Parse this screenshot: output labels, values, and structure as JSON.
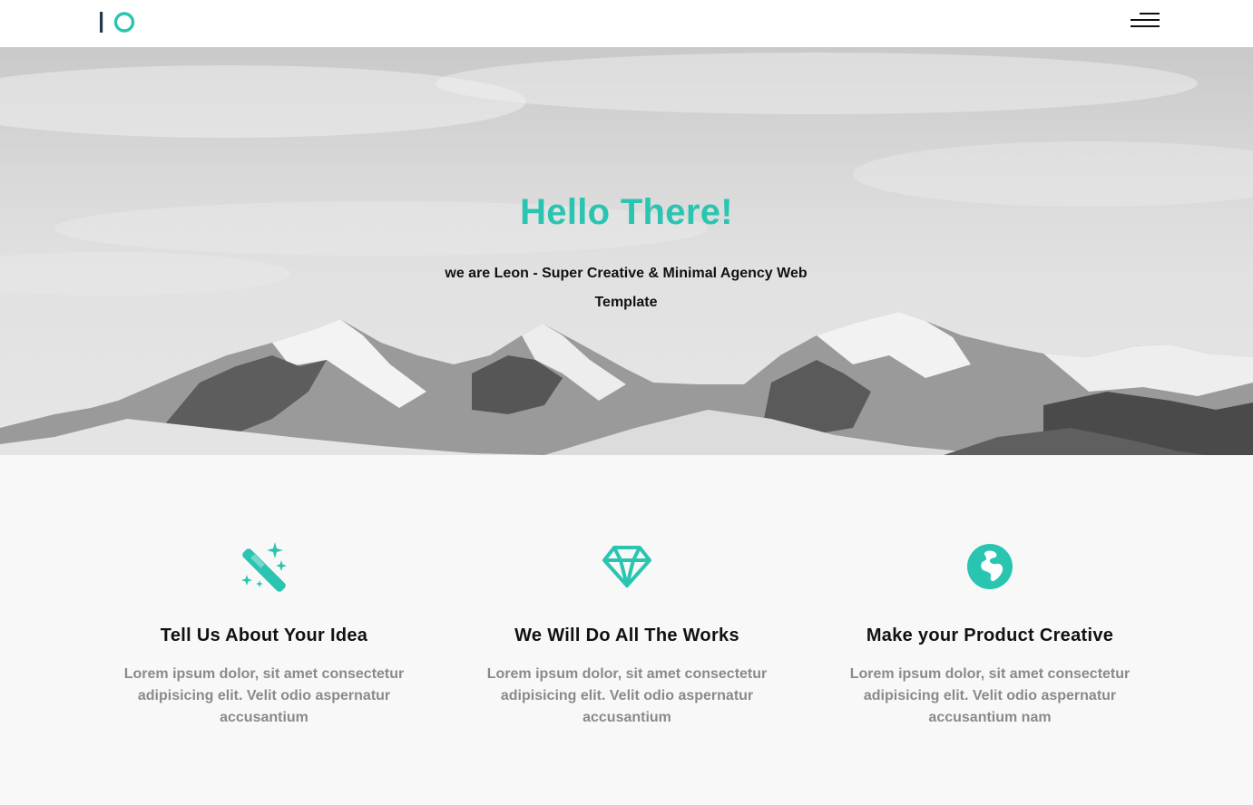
{
  "brand": {
    "logo_text": "IO",
    "accent_color": "#2ac5b1"
  },
  "header": {
    "menu_icon": "hamburger-menu-icon"
  },
  "hero": {
    "title": "Hello There!",
    "subtitle": "we are Leon - Super Creative & Minimal Agency Web Template"
  },
  "features": [
    {
      "icon": "magic-wand-icon",
      "title": "Tell Us About Your Idea",
      "text": "Lorem ipsum dolor, sit amet consectetur adipisicing elit. Velit odio aspernatur accusantium"
    },
    {
      "icon": "diamond-icon",
      "title": "We Will Do All The Works",
      "text": "Lorem ipsum dolor, sit amet consectetur adipisicing elit. Velit odio aspernatur accusantium"
    },
    {
      "icon": "globe-icon",
      "title": "Make your Product Creative",
      "text": "Lorem ipsum dolor, sit amet consectetur adipisicing elit. Velit odio aspernatur accusantium nam"
    }
  ]
}
